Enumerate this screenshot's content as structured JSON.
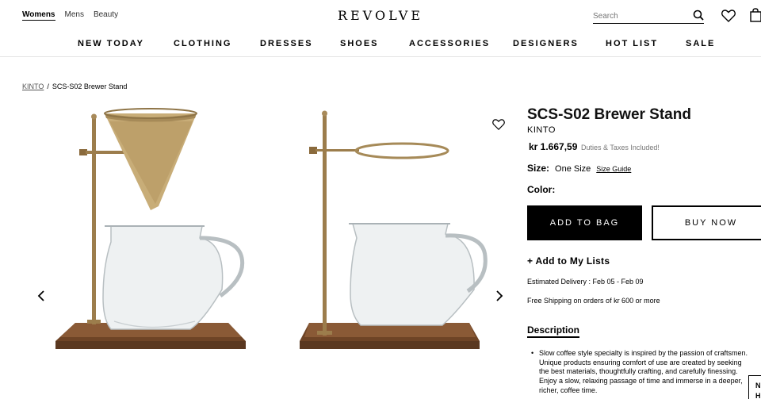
{
  "topbar": {
    "segments": [
      "Womens",
      "Mens",
      "Beauty"
    ],
    "logo": "REVOLVE",
    "search_placeholder": "Search"
  },
  "nav": [
    "NEW TODAY",
    "CLOTHING",
    "DRESSES",
    "SHOES",
    "ACCESSORIES",
    "DESIGNERS",
    "HOT LIST",
    "SALE"
  ],
  "breadcrumb": {
    "brand": "KINTO",
    "separator": "/",
    "product": "SCS-S02 Brewer Stand"
  },
  "product": {
    "title": "SCS-S02 Brewer Stand",
    "brand": "KINTO",
    "price": "kr 1.667,59",
    "duties": "Duties & Taxes Included!",
    "size_label": "Size:",
    "size_value": "One Size",
    "size_guide": "Size Guide",
    "color_label": "Color:",
    "add_to_bag": "ADD TO BAG",
    "buy_now": "BUY NOW",
    "add_to_lists": "+ Add to My Lists",
    "delivery": "Estimated Delivery : Feb 05 - Feb 09",
    "shipping": "Free Shipping on orders of kr 600 or more",
    "description_heading": "Description",
    "description_lines": [
      "Slow coffee style specialty is inspired by the passion of craftsmen.",
      "Unique products ensuring comfort of use are created by seeking",
      "the best materials, thoughtfully crafting, and carefully finessing.",
      "Enjoy a slow, relaxing passage of time and immerse in a deeper,",
      "richer, coffee time."
    ]
  },
  "chat_tab": [
    "N",
    "H"
  ],
  "colors": {
    "accent": "#000000",
    "wood": "#7a4a2c",
    "brass": "#a88a5a"
  }
}
